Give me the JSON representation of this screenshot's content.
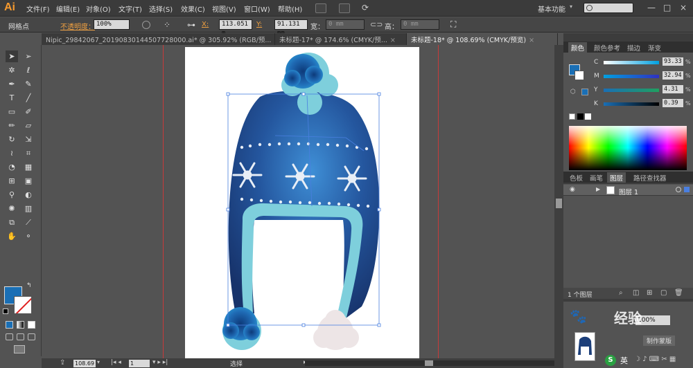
{
  "app": {
    "logo": "Ai"
  },
  "menu": {
    "items": [
      "文件(F)",
      "编辑(E)",
      "对象(O)",
      "文字(T)",
      "选择(S)",
      "效果(C)",
      "视图(V)",
      "窗口(W)",
      "帮助(H)"
    ],
    "workspace": "基本功能",
    "window_buttons": [
      "—",
      "□",
      "×"
    ]
  },
  "control_bar": {
    "mode_label": "网格点",
    "opacity_label": "不透明度：",
    "opacity_value": "100%",
    "x_label": "X:",
    "x_value": "113.051 m",
    "y_label": "Y:",
    "y_value": "91.131 mm",
    "w_label": "宽：",
    "w_value": "0 mm",
    "h_label": "高：",
    "h_value": "0 mm"
  },
  "doc_tabs": [
    {
      "label": "Nipic_29842067_20190830144507728000.ai* @ 305.92% (RGB/预..."
    },
    {
      "label": "未标题-17* @ 174.6% (CMYK/预..."
    },
    {
      "label": "未标题-18* @ 108.69% (CMYK/预览)"
    }
  ],
  "status_bar": {
    "zoom": "108.69",
    "page": "1",
    "tool_status": "选择"
  },
  "colors": {
    "fill": "#1a6fb5",
    "stroke": "#ffffff",
    "accent": "#f0a040",
    "hat_dark": "#1c3f7a",
    "hat_light": "#7ecfdc"
  },
  "color_panel": {
    "tabs": [
      "颜色",
      "颜色参考",
      "描边",
      "渐变"
    ],
    "channels": [
      {
        "name": "C",
        "value": "93.33",
        "unit": "%"
      },
      {
        "name": "M",
        "value": "32.94",
        "unit": "%"
      },
      {
        "name": "Y",
        "value": "4.31",
        "unit": "%"
      },
      {
        "name": "K",
        "value": "0.39",
        "unit": "%"
      }
    ]
  },
  "layers_panel": {
    "tabs": [
      "色板",
      "画笔",
      "图层",
      "路径查找器"
    ],
    "layer_name": "图层 1",
    "footer": "1 个图层"
  },
  "navigator": {
    "zoom": "100%",
    "make_mask": "制作蒙版"
  },
  "overlay": {
    "watermark": "经验",
    "ime": "英"
  }
}
